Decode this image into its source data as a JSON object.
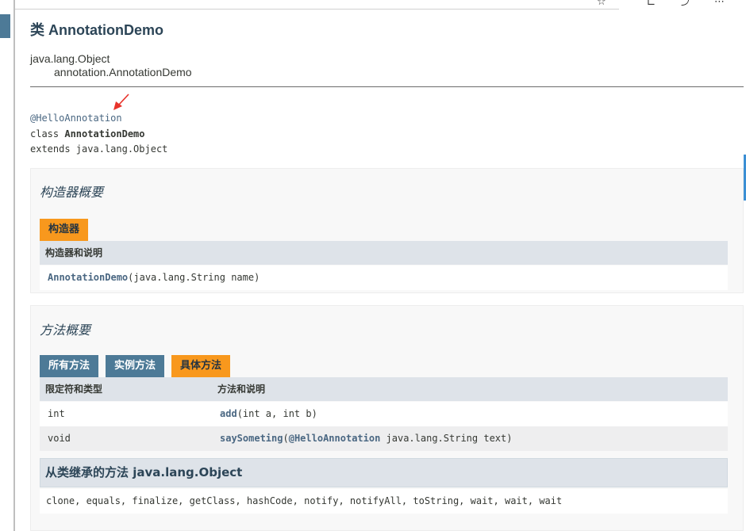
{
  "header": {
    "title": "类 AnnotationDemo",
    "parent_class": "java.lang.Object",
    "child_class": "annotation.AnnotationDemo"
  },
  "declaration": {
    "annotation": "@HelloAnnotation",
    "class_keyword": "class",
    "class_name": "AnnotationDemo",
    "extends_line": "extends java.lang.Object"
  },
  "constructor_summary": {
    "title": "构造器概要",
    "tab": "构造器",
    "column": "构造器和说明",
    "rows": [
      {
        "name": "AnnotationDemo",
        "params": "(java.lang.String name)"
      }
    ]
  },
  "method_summary": {
    "title": "方法概要",
    "tabs": [
      "所有方法",
      "实例方法",
      "具体方法"
    ],
    "columns": [
      "限定符和类型",
      "方法和说明"
    ],
    "rows": [
      {
        "type": "int",
        "name": "add",
        "params": "(int a,  int b)"
      },
      {
        "type": "void",
        "name": "saySometing",
        "paren": "(",
        "anno": "@HelloAnnotation",
        "params": " java.lang.String text)"
      }
    ],
    "inherited_title": "从类继承的方法 java.lang.Object",
    "inherited_methods": "clone,  equals,  finalize,  getClass,  hashCode,  notify,  notifyAll,  toString,  wait,  wait,  wait"
  },
  "colors": {
    "accent_orange": "#f8981d",
    "tab_blue": "#4d7a97",
    "header_gray": "#dee3e9",
    "arrow_red": "#e8332b"
  }
}
